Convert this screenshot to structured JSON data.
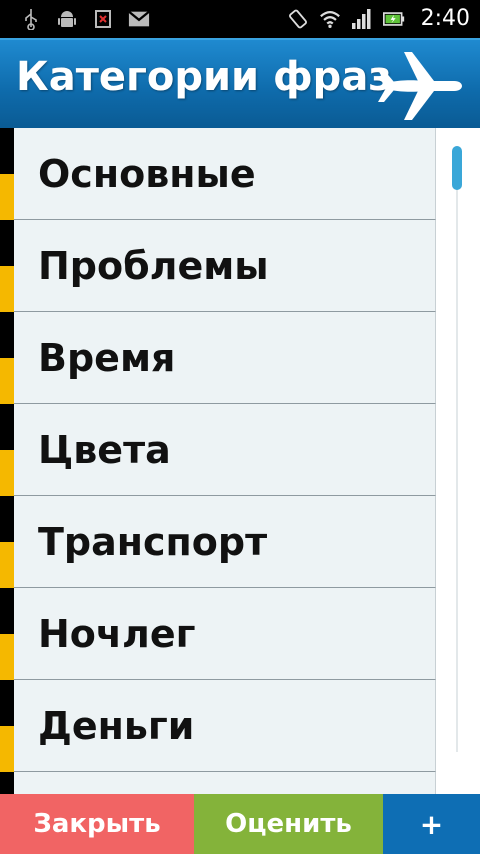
{
  "status_bar": {
    "time": "2:40",
    "icons": [
      "usb-icon",
      "android-debug-icon",
      "no-sim-icon",
      "gmail-icon",
      "screen-rotate-icon",
      "wifi-icon",
      "signal-icon",
      "battery-charging-icon"
    ]
  },
  "header": {
    "title": "Категории фраз",
    "icon": "airplane-icon"
  },
  "categories": [
    {
      "label": "Основные"
    },
    {
      "label": "Проблемы"
    },
    {
      "label": "Время"
    },
    {
      "label": "Цвета"
    },
    {
      "label": "Транспорт"
    },
    {
      "label": "Ночлег"
    },
    {
      "label": "Деньги"
    },
    {
      "label": ""
    }
  ],
  "buttons": {
    "close": "Закрыть",
    "rate": "Оценить",
    "add": "+"
  },
  "colors": {
    "header": "#0e6aaa",
    "close_button": "#f16464",
    "rate_button": "#84b33a",
    "add_button": "#0e6eb4",
    "strip_yellow": "#f5b800",
    "scroll_thumb": "#3aa7d8"
  }
}
